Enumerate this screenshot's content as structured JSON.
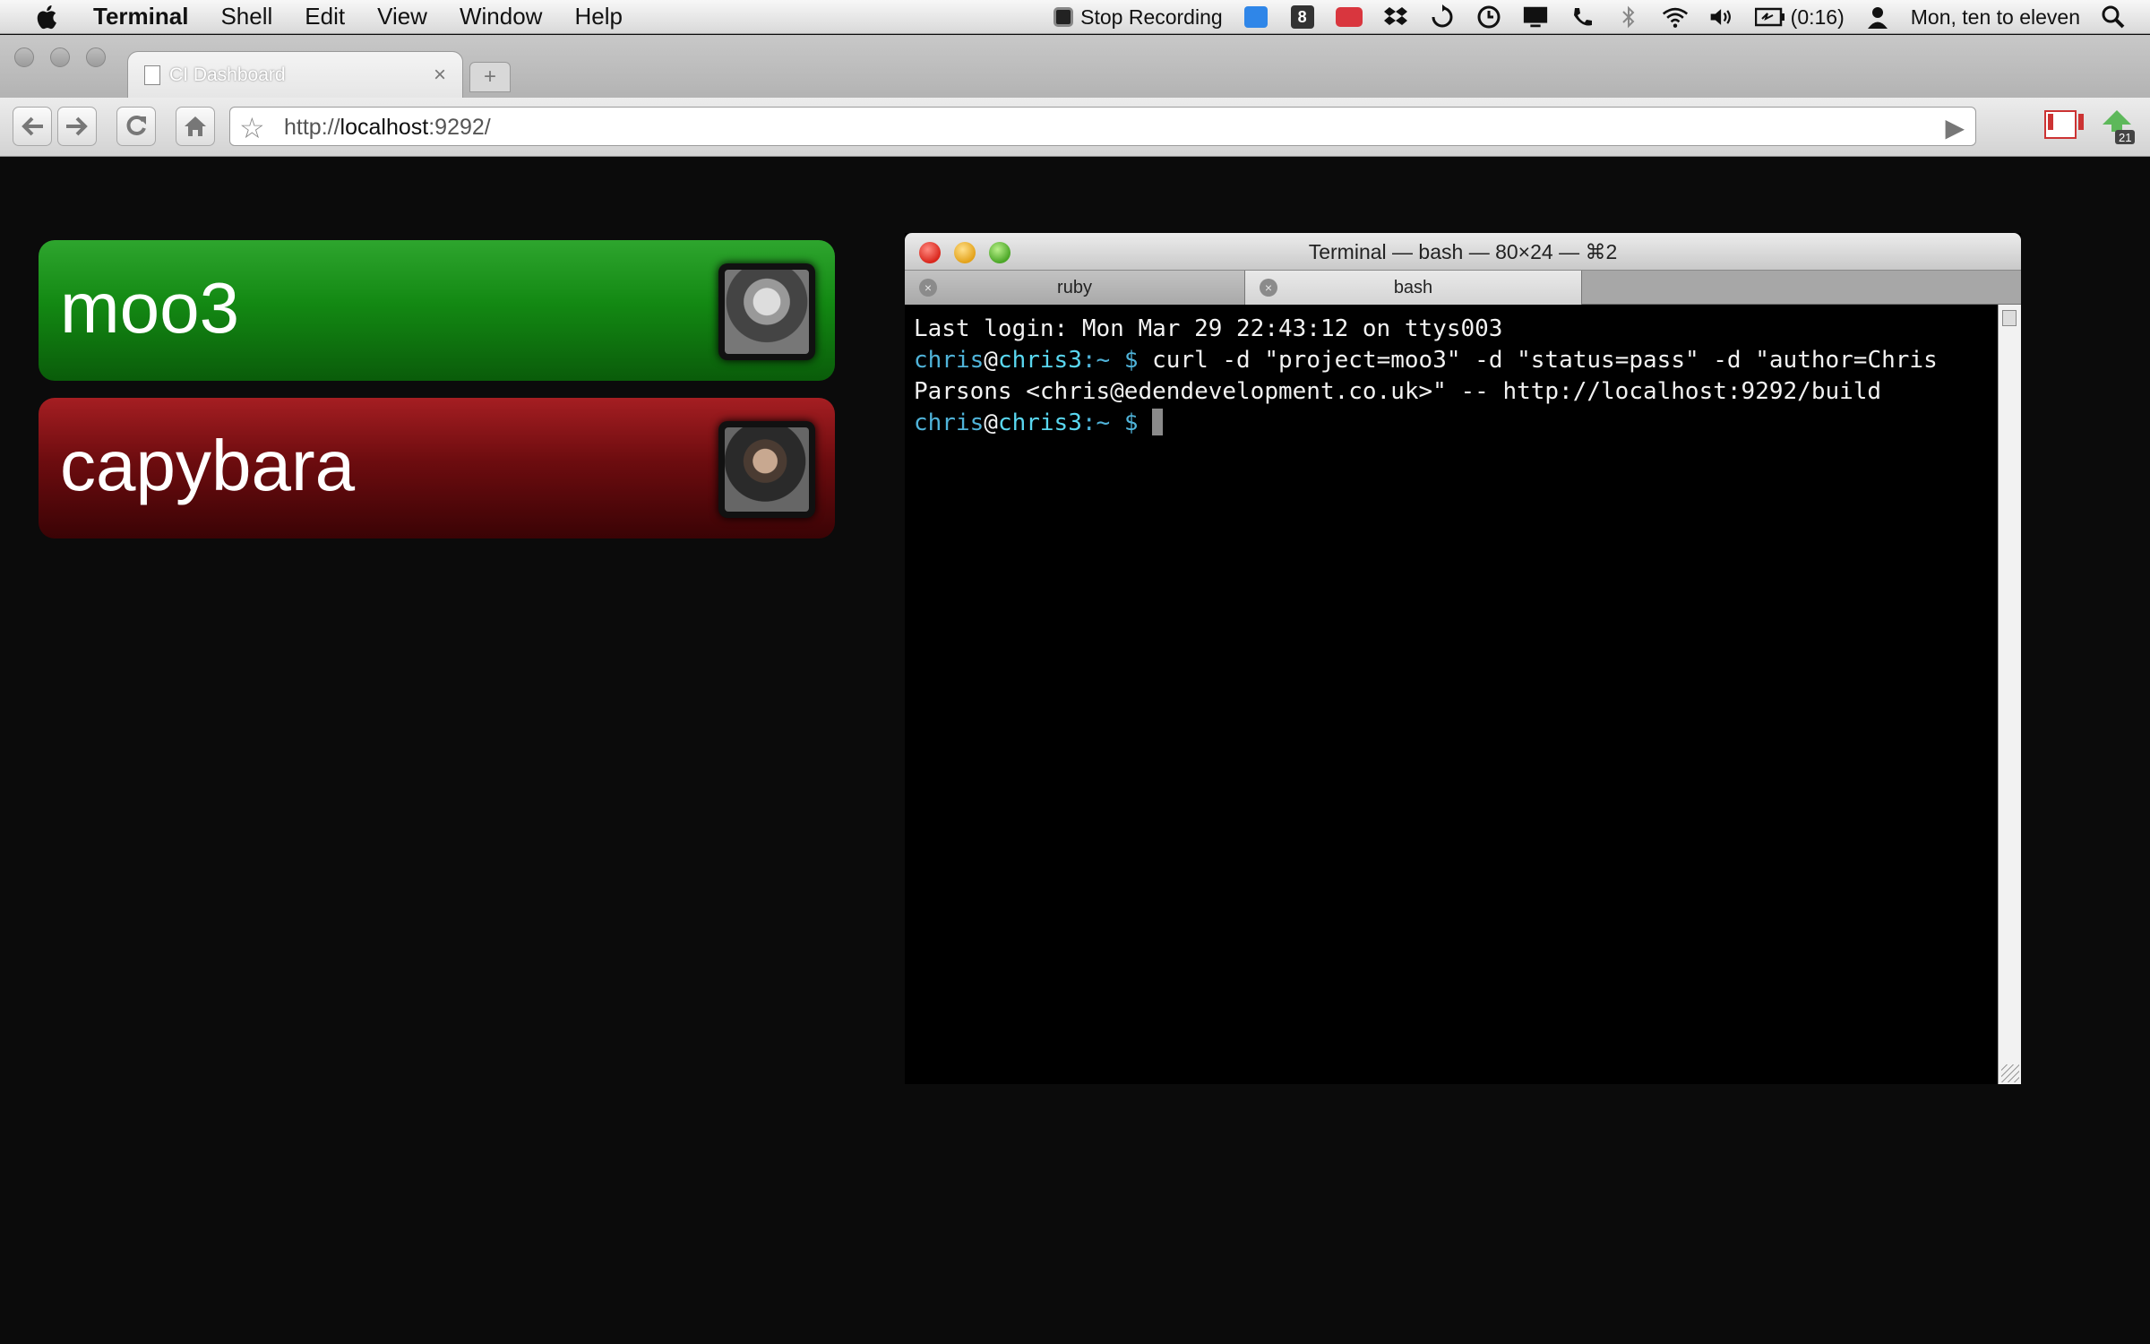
{
  "menubar": {
    "app_name": "Terminal",
    "items": [
      "Shell",
      "Edit",
      "View",
      "Window",
      "Help"
    ],
    "stop_recording": "Stop Recording",
    "battery_time": "(0:16)",
    "clock": "Mon, ten to eleven",
    "icons": [
      "apple-icon",
      "stop-recording-icon",
      "skype-icon",
      "growl-icon",
      "dropbox-icon",
      "sync-icon",
      "time-machine-icon",
      "display-icon",
      "phone-icon",
      "bluetooth-icon",
      "wifi-icon",
      "volume-icon",
      "battery-icon",
      "user-icon",
      "spotlight-icon"
    ],
    "dark_icon_label": "8"
  },
  "browser": {
    "tab_title": "CI Dashboard",
    "url_prefix": "http://",
    "url_host": "localhost",
    "url_rest": ":9292/",
    "extension_badge": "21"
  },
  "projects": [
    {
      "name": "moo3",
      "status": "pass",
      "status_color": "#138913"
    },
    {
      "name": "capybara",
      "status": "fail",
      "status_color": "#6d0c0f"
    }
  ],
  "terminal": {
    "title": "Terminal — bash — 80×24 — ⌘2",
    "tabs": [
      "ruby",
      "bash"
    ],
    "last_login": "Last login: Mon Mar 29 22:43:12 on ttys003",
    "prompt_user": "chris",
    "prompt_at": "@",
    "prompt_host": "chris3",
    "prompt_suffix": ":~ $ ",
    "command": "curl -d \"project=moo3\" -d \"status=pass\" -d \"author=Chris Parsons <chris@edendevelopment.co.uk>\" -- http://localhost:9292/build"
  }
}
